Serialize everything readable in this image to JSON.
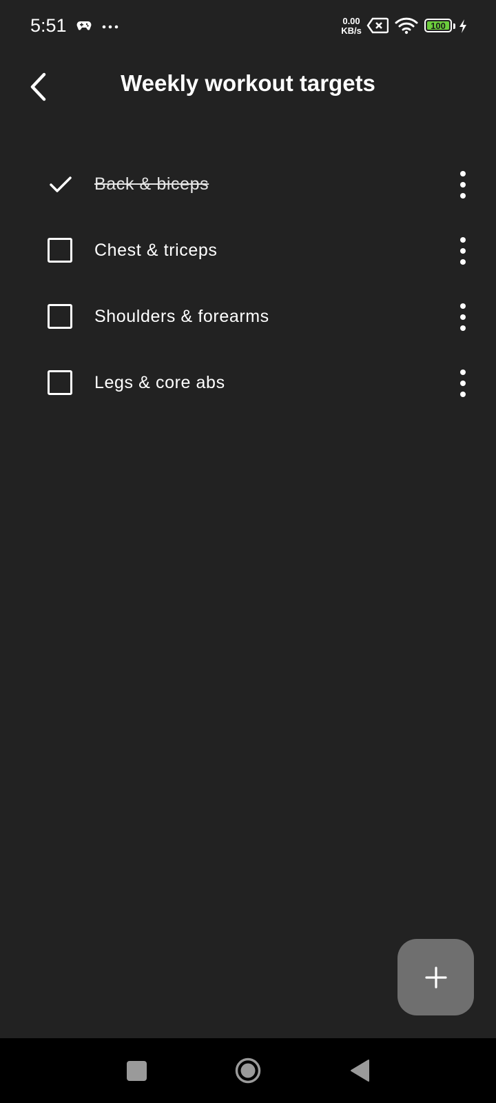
{
  "status_bar": {
    "time": "5:51",
    "net_speed_value": "0.00",
    "net_speed_unit": "KB/s",
    "battery_level": "100",
    "battery_color": "#6ccd3c",
    "icons": [
      "gamepad-icon",
      "more-dots-icon",
      "sim-off-icon",
      "wifi-icon",
      "battery-icon",
      "charging-icon"
    ]
  },
  "header": {
    "title": "Weekly workout targets",
    "back_icon": "chevron-left-icon"
  },
  "tasks": [
    {
      "label": "Back & biceps",
      "done": true
    },
    {
      "label": "Chest & triceps",
      "done": false
    },
    {
      "label": "Shoulders & forearms",
      "done": false
    },
    {
      "label": "Legs & core abs",
      "done": false
    }
  ],
  "fab": {
    "icon": "plus-icon",
    "color": "#6f6f6f"
  },
  "nav_bar": {
    "icons": [
      "recents-square-icon",
      "home-circle-icon",
      "back-triangle-icon"
    ]
  },
  "colors": {
    "background": "#222222",
    "text": "#ffffff"
  }
}
